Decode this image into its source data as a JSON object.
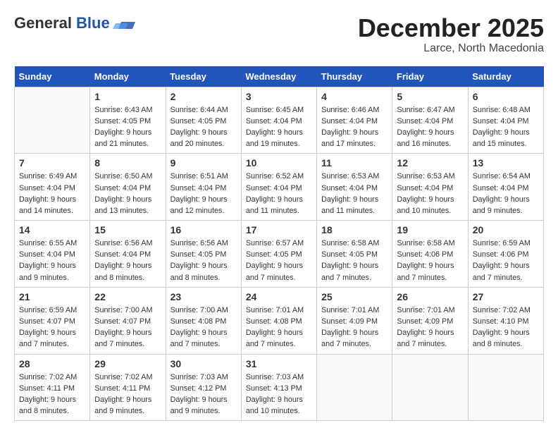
{
  "header": {
    "logo_general": "General",
    "logo_blue": "Blue",
    "month_title": "December 2025",
    "location": "Larce, North Macedonia"
  },
  "days_of_week": [
    "Sunday",
    "Monday",
    "Tuesday",
    "Wednesday",
    "Thursday",
    "Friday",
    "Saturday"
  ],
  "weeks": [
    [
      {
        "day": "",
        "info": ""
      },
      {
        "day": "1",
        "info": "Sunrise: 6:43 AM\nSunset: 4:05 PM\nDaylight: 9 hours\nand 21 minutes."
      },
      {
        "day": "2",
        "info": "Sunrise: 6:44 AM\nSunset: 4:05 PM\nDaylight: 9 hours\nand 20 minutes."
      },
      {
        "day": "3",
        "info": "Sunrise: 6:45 AM\nSunset: 4:04 PM\nDaylight: 9 hours\nand 19 minutes."
      },
      {
        "day": "4",
        "info": "Sunrise: 6:46 AM\nSunset: 4:04 PM\nDaylight: 9 hours\nand 17 minutes."
      },
      {
        "day": "5",
        "info": "Sunrise: 6:47 AM\nSunset: 4:04 PM\nDaylight: 9 hours\nand 16 minutes."
      },
      {
        "day": "6",
        "info": "Sunrise: 6:48 AM\nSunset: 4:04 PM\nDaylight: 9 hours\nand 15 minutes."
      }
    ],
    [
      {
        "day": "7",
        "info": "Sunrise: 6:49 AM\nSunset: 4:04 PM\nDaylight: 9 hours\nand 14 minutes."
      },
      {
        "day": "8",
        "info": "Sunrise: 6:50 AM\nSunset: 4:04 PM\nDaylight: 9 hours\nand 13 minutes."
      },
      {
        "day": "9",
        "info": "Sunrise: 6:51 AM\nSunset: 4:04 PM\nDaylight: 9 hours\nand 12 minutes."
      },
      {
        "day": "10",
        "info": "Sunrise: 6:52 AM\nSunset: 4:04 PM\nDaylight: 9 hours\nand 11 minutes."
      },
      {
        "day": "11",
        "info": "Sunrise: 6:53 AM\nSunset: 4:04 PM\nDaylight: 9 hours\nand 11 minutes."
      },
      {
        "day": "12",
        "info": "Sunrise: 6:53 AM\nSunset: 4:04 PM\nDaylight: 9 hours\nand 10 minutes."
      },
      {
        "day": "13",
        "info": "Sunrise: 6:54 AM\nSunset: 4:04 PM\nDaylight: 9 hours\nand 9 minutes."
      }
    ],
    [
      {
        "day": "14",
        "info": "Sunrise: 6:55 AM\nSunset: 4:04 PM\nDaylight: 9 hours\nand 9 minutes."
      },
      {
        "day": "15",
        "info": "Sunrise: 6:56 AM\nSunset: 4:04 PM\nDaylight: 9 hours\nand 8 minutes."
      },
      {
        "day": "16",
        "info": "Sunrise: 6:56 AM\nSunset: 4:05 PM\nDaylight: 9 hours\nand 8 minutes."
      },
      {
        "day": "17",
        "info": "Sunrise: 6:57 AM\nSunset: 4:05 PM\nDaylight: 9 hours\nand 7 minutes."
      },
      {
        "day": "18",
        "info": "Sunrise: 6:58 AM\nSunset: 4:05 PM\nDaylight: 9 hours\nand 7 minutes."
      },
      {
        "day": "19",
        "info": "Sunrise: 6:58 AM\nSunset: 4:06 PM\nDaylight: 9 hours\nand 7 minutes."
      },
      {
        "day": "20",
        "info": "Sunrise: 6:59 AM\nSunset: 4:06 PM\nDaylight: 9 hours\nand 7 minutes."
      }
    ],
    [
      {
        "day": "21",
        "info": "Sunrise: 6:59 AM\nSunset: 4:07 PM\nDaylight: 9 hours\nand 7 minutes."
      },
      {
        "day": "22",
        "info": "Sunrise: 7:00 AM\nSunset: 4:07 PM\nDaylight: 9 hours\nand 7 minutes."
      },
      {
        "day": "23",
        "info": "Sunrise: 7:00 AM\nSunset: 4:08 PM\nDaylight: 9 hours\nand 7 minutes."
      },
      {
        "day": "24",
        "info": "Sunrise: 7:01 AM\nSunset: 4:08 PM\nDaylight: 9 hours\nand 7 minutes."
      },
      {
        "day": "25",
        "info": "Sunrise: 7:01 AM\nSunset: 4:09 PM\nDaylight: 9 hours\nand 7 minutes."
      },
      {
        "day": "26",
        "info": "Sunrise: 7:01 AM\nSunset: 4:09 PM\nDaylight: 9 hours\nand 7 minutes."
      },
      {
        "day": "27",
        "info": "Sunrise: 7:02 AM\nSunset: 4:10 PM\nDaylight: 9 hours\nand 8 minutes."
      }
    ],
    [
      {
        "day": "28",
        "info": "Sunrise: 7:02 AM\nSunset: 4:11 PM\nDaylight: 9 hours\nand 8 minutes."
      },
      {
        "day": "29",
        "info": "Sunrise: 7:02 AM\nSunset: 4:11 PM\nDaylight: 9 hours\nand 9 minutes."
      },
      {
        "day": "30",
        "info": "Sunrise: 7:03 AM\nSunset: 4:12 PM\nDaylight: 9 hours\nand 9 minutes."
      },
      {
        "day": "31",
        "info": "Sunrise: 7:03 AM\nSunset: 4:13 PM\nDaylight: 9 hours\nand 10 minutes."
      },
      {
        "day": "",
        "info": ""
      },
      {
        "day": "",
        "info": ""
      },
      {
        "day": "",
        "info": ""
      }
    ]
  ]
}
